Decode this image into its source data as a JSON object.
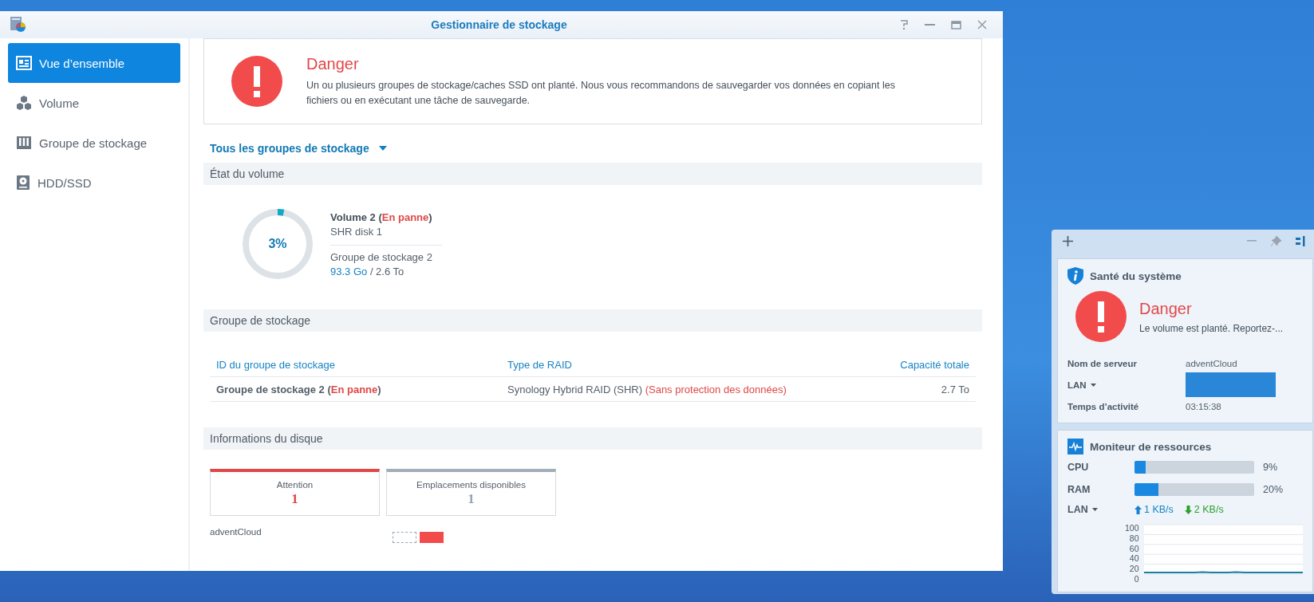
{
  "window": {
    "title": "Gestionnaire de stockage"
  },
  "sidebar": {
    "items": [
      {
        "label": "Vue d’ensemble",
        "kind": "overview",
        "selected": true
      },
      {
        "label": "Volume",
        "kind": "volume",
        "selected": false
      },
      {
        "label": "Groupe de stockage",
        "kind": "pool",
        "selected": false
      },
      {
        "label": "HDD/SSD",
        "kind": "disk",
        "selected": false
      }
    ]
  },
  "alert": {
    "title": "Danger",
    "message": "Un ou plusieurs groupes de stockage/caches SSD ont planté. Nous vous recommandons de sauvegarder vos données en copiant les fichiers ou en exécutant une tâche de sauvegarde."
  },
  "filter": {
    "label": "Tous les groupes de stockage"
  },
  "volume_section": {
    "title": "État du volume",
    "volume": {
      "name": [
        {
          "text": "Volume 2 (",
          "kind": "normal"
        },
        {
          "text": "En panne",
          "kind": "error"
        },
        {
          "text": ")",
          "kind": "normal"
        }
      ],
      "level": 0.03,
      "percent": "3%",
      "description": "SHR disk 1",
      "pool": "Groupe de stockage 2",
      "used": "93.3 Go",
      "total": "/ 2.6 To"
    }
  },
  "pool_section": {
    "title": "Groupe de stockage",
    "columns": [
      "ID du groupe de stockage",
      "Type de RAID",
      "Capacité totale"
    ],
    "rows": [
      {
        "id": [
          {
            "text": "Groupe de stockage 2 (",
            "kind": "normal"
          },
          {
            "text": "En panne",
            "kind": "error"
          },
          {
            "text": ")",
            "kind": "normal"
          }
        ],
        "raid": [
          {
            "text": "Synology Hybrid RAID (SHR) ",
            "kind": "normal"
          },
          {
            "text": "(Sans protection des données)",
            "kind": "warning"
          }
        ],
        "capacity": "2.7 To"
      }
    ]
  },
  "disk_section": {
    "title": "Informations du disque",
    "cards": [
      {
        "label": "Attention",
        "count": "1",
        "kind": "warning"
      },
      {
        "label": "Emplacements disponibles",
        "count": "1",
        "kind": "available"
      }
    ],
    "servers": [
      {
        "name": "adventCloud",
        "slots": [
          {
            "kind": "empty"
          },
          {
            "kind": "failed"
          }
        ]
      }
    ]
  },
  "widgets": {
    "system_health": {
      "title": "Santé du système",
      "status": "Danger",
      "message": "Le volume est planté. Reportez-...",
      "rows": [
        {
          "label": "Nom de serveur",
          "kind": "text",
          "value": "adventCloud"
        },
        {
          "label": "LAN",
          "kind": "redacted"
        },
        {
          "label": "Temps d’activité",
          "kind": "text",
          "value": "03:15:38"
        }
      ]
    },
    "resource_monitor": {
      "title": "Moniteur de ressources",
      "meters": [
        {
          "label": "CPU",
          "level": 0.09,
          "reading": "9%"
        },
        {
          "label": "RAM",
          "level": 0.2,
          "reading": "20%"
        }
      ],
      "lan": {
        "label": "LAN",
        "upload": "1 KB/s",
        "download": "2 KB/s",
        "chart_data": {
          "type": "line",
          "grid": true,
          "ylim": [
            0,
            100
          ],
          "yticks": [
            0,
            20,
            40,
            60,
            80,
            100
          ],
          "series": [
            {
              "color": "#1a7fa8",
              "values": [
                3,
                3,
                3,
                3,
                3,
                3,
                3,
                4,
                3,
                3,
                3,
                4,
                3,
                3,
                3,
                3,
                3,
                3,
                3,
                3
              ]
            }
          ]
        }
      }
    }
  }
}
